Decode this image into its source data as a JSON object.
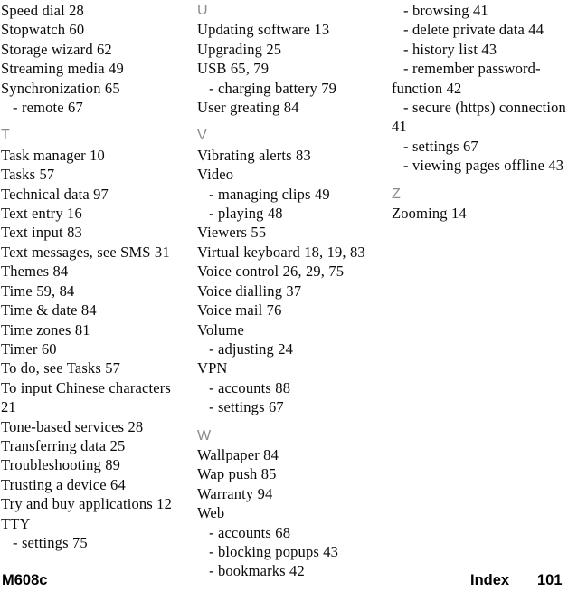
{
  "document": {
    "type": "index-page",
    "footer": {
      "model": "M608c",
      "section": "Index",
      "page_number": "101"
    }
  },
  "columns": [
    {
      "id": "column-1",
      "blocks": [
        {
          "kind": "entry",
          "text": "Speed dial 28"
        },
        {
          "kind": "entry",
          "text": "Stopwatch 60"
        },
        {
          "kind": "entry",
          "text": "Storage wizard 62"
        },
        {
          "kind": "entry",
          "text": "Streaming media 49"
        },
        {
          "kind": "entry",
          "text": "Synchronization 65"
        },
        {
          "kind": "sub",
          "text": "- remote 67"
        },
        {
          "kind": "letter",
          "text": "T"
        },
        {
          "kind": "entry",
          "text": "Task manager 10"
        },
        {
          "kind": "entry",
          "text": "Tasks 57"
        },
        {
          "kind": "entry",
          "text": "Technical data 97"
        },
        {
          "kind": "entry",
          "text": "Text entry 16"
        },
        {
          "kind": "entry",
          "text": "Text input 83"
        },
        {
          "kind": "entry",
          "text": "Text messages, see SMS 31"
        },
        {
          "kind": "entry",
          "text": "Themes 84"
        },
        {
          "kind": "entry",
          "text": "Time 59, 84"
        },
        {
          "kind": "entry",
          "text": "Time & date 84"
        },
        {
          "kind": "entry",
          "text": "Time zones 81"
        },
        {
          "kind": "entry",
          "text": "Timer 60"
        },
        {
          "kind": "entry",
          "text": "To do, see Tasks 57"
        },
        {
          "kind": "entry",
          "text": "To input Chinese characters"
        },
        {
          "kind": "entry",
          "text": "21"
        },
        {
          "kind": "entry",
          "text": "Tone-based services 28"
        },
        {
          "kind": "entry",
          "text": "Transferring data 25"
        },
        {
          "kind": "entry",
          "text": "Troubleshooting 89"
        },
        {
          "kind": "entry",
          "text": "Trusting a device 64"
        },
        {
          "kind": "entry",
          "text": "Try and buy applications 12"
        },
        {
          "kind": "entry",
          "text": "TTY"
        },
        {
          "kind": "sub",
          "text": "- settings 75"
        }
      ]
    },
    {
      "id": "column-2",
      "blocks": [
        {
          "kind": "letter-first",
          "text": "U"
        },
        {
          "kind": "entry",
          "text": "Updating software 13"
        },
        {
          "kind": "entry",
          "text": "Upgrading 25"
        },
        {
          "kind": "entry",
          "text": "USB 65, 79"
        },
        {
          "kind": "sub",
          "text": "- charging battery 79"
        },
        {
          "kind": "entry",
          "text": "User greating 84"
        },
        {
          "kind": "letter",
          "text": "V"
        },
        {
          "kind": "entry",
          "text": "Vibrating alerts 83"
        },
        {
          "kind": "entry",
          "text": "Video"
        },
        {
          "kind": "sub",
          "text": "- managing clips 49"
        },
        {
          "kind": "sub",
          "text": "- playing 48"
        },
        {
          "kind": "entry",
          "text": "Viewers 55"
        },
        {
          "kind": "entry",
          "text": "Virtual keyboard 18, 19, 83"
        },
        {
          "kind": "entry",
          "text": "Voice control 26, 29, 75"
        },
        {
          "kind": "entry",
          "text": "Voice dialling 37"
        },
        {
          "kind": "entry",
          "text": "Voice mail 76"
        },
        {
          "kind": "entry",
          "text": "Volume"
        },
        {
          "kind": "sub",
          "text": "- adjusting 24"
        },
        {
          "kind": "entry",
          "text": "VPN"
        },
        {
          "kind": "sub",
          "text": "- accounts 88"
        },
        {
          "kind": "sub",
          "text": "- settings 67"
        },
        {
          "kind": "letter",
          "text": "W"
        },
        {
          "kind": "entry",
          "text": "Wallpaper 84"
        },
        {
          "kind": "entry",
          "text": "Wap push 85"
        },
        {
          "kind": "entry",
          "text": "Warranty 94"
        },
        {
          "kind": "entry",
          "text": "Web"
        },
        {
          "kind": "sub",
          "text": "- accounts 68"
        },
        {
          "kind": "sub",
          "text": "- blocking popups 43"
        },
        {
          "kind": "sub",
          "text": "- bookmarks 42"
        }
      ]
    },
    {
      "id": "column-3",
      "blocks": [
        {
          "kind": "sub",
          "text": "- browsing 41"
        },
        {
          "kind": "sub",
          "text": "- delete private data 44"
        },
        {
          "kind": "sub",
          "text": "- history list 43"
        },
        {
          "kind": "sub",
          "text": "- remember password-"
        },
        {
          "kind": "entry",
          "text": "function 42"
        },
        {
          "kind": "sub",
          "text": "- secure (https) connection"
        },
        {
          "kind": "entry",
          "text": "41"
        },
        {
          "kind": "sub",
          "text": "- settings 67"
        },
        {
          "kind": "sub",
          "text": "- viewing pages offline 43"
        },
        {
          "kind": "letter",
          "text": "Z"
        },
        {
          "kind": "entry",
          "text": "Zooming 14"
        }
      ]
    }
  ]
}
